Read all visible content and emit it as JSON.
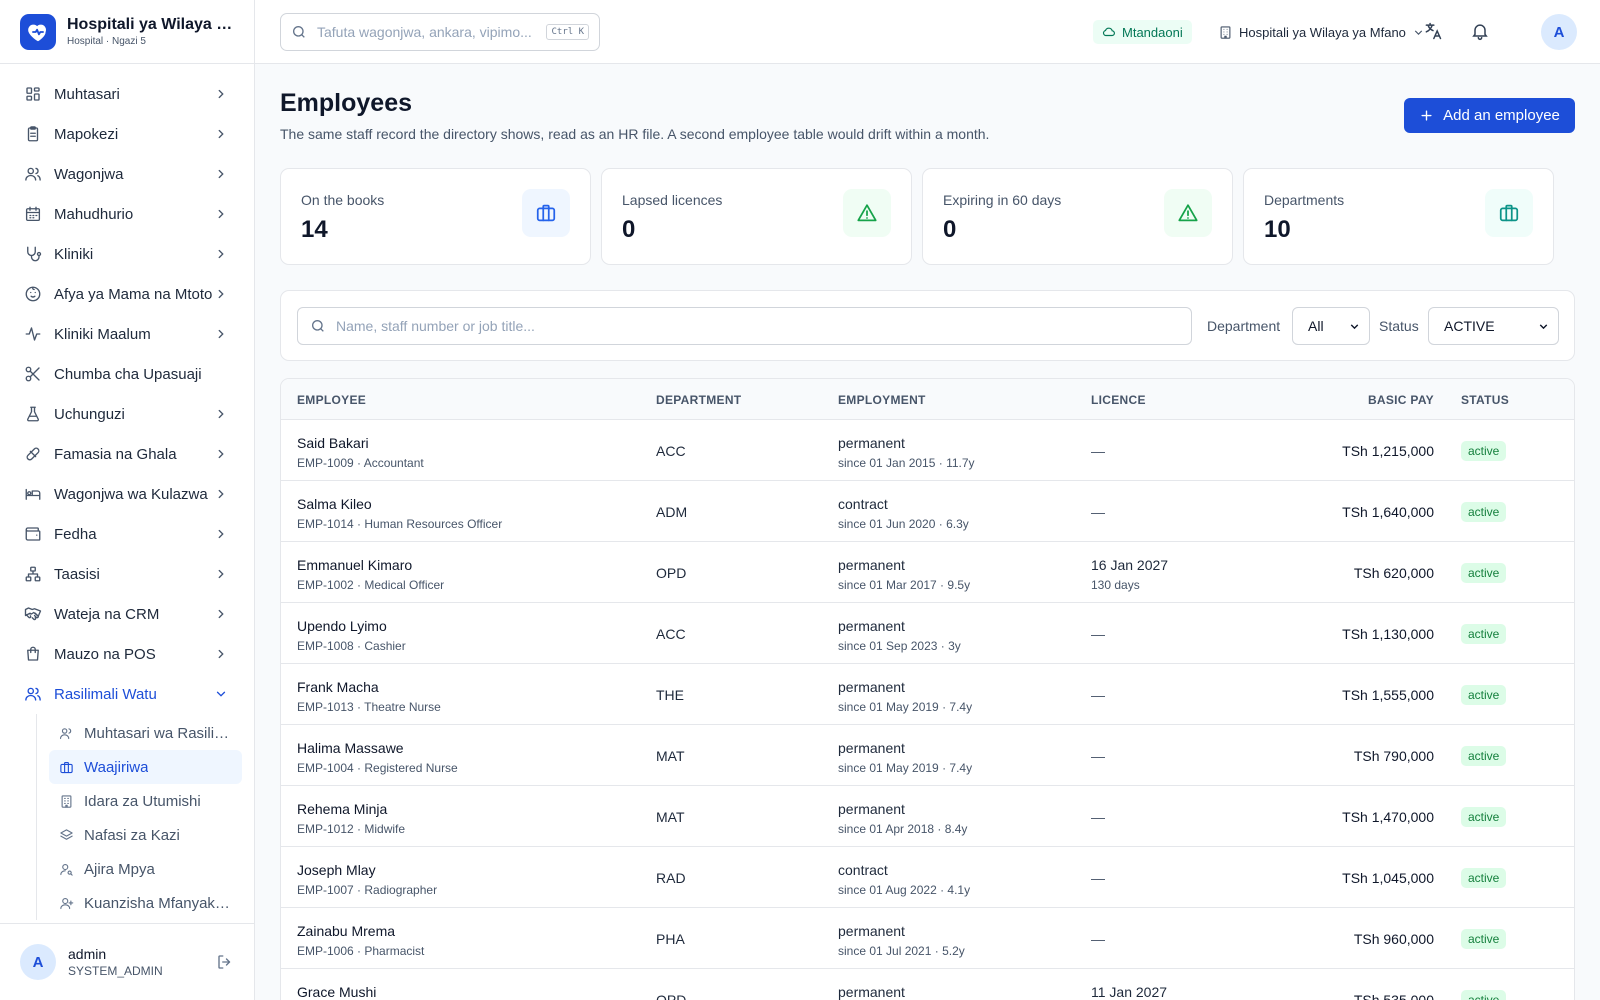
{
  "brand": {
    "title": "Hospitali ya Wilaya ya Mfano",
    "subtitle": "Hospital · Ngazi 5"
  },
  "nav": [
    {
      "label": "Muhtasari",
      "icon": "dashboard-icon",
      "chevron": "right"
    },
    {
      "label": "Mapokezi",
      "icon": "clipboard-icon",
      "chevron": "right"
    },
    {
      "label": "Wagonjwa",
      "icon": "users-icon",
      "chevron": "right"
    },
    {
      "label": "Mahudhurio",
      "icon": "calendar-icon",
      "chevron": "right"
    },
    {
      "label": "Kliniki",
      "icon": "stethoscope-icon",
      "chevron": "right"
    },
    {
      "label": "Afya ya Mama na Mtoto",
      "icon": "baby-icon",
      "chevron": "right"
    },
    {
      "label": "Kliniki Maalum",
      "icon": "activity-icon",
      "chevron": "right"
    },
    {
      "label": "Chumba cha Upasuaji",
      "icon": "scissors-icon",
      "chevron": ""
    },
    {
      "label": "Uchunguzi",
      "icon": "flask-icon",
      "chevron": "right"
    },
    {
      "label": "Famasia na Ghala",
      "icon": "pill-icon",
      "chevron": "right"
    },
    {
      "label": "Wagonjwa wa Kulazwa",
      "icon": "bed-icon",
      "chevron": "right"
    },
    {
      "label": "Fedha",
      "icon": "wallet-icon",
      "chevron": "right"
    },
    {
      "label": "Taasisi",
      "icon": "org-chart-icon",
      "chevron": "right"
    },
    {
      "label": "Wateja na CRM",
      "icon": "handshake-icon",
      "chevron": "right"
    },
    {
      "label": "Mauzo na POS",
      "icon": "shopping-bag-icon",
      "chevron": "right"
    },
    {
      "label": "Rasilimali Watu",
      "icon": "users-icon",
      "chevron": "down"
    }
  ],
  "subnav": [
    {
      "label": "Muhtasari wa Rasilimali Watu",
      "icon": "users-small-icon",
      "active": false
    },
    {
      "label": "Waajiriwa",
      "icon": "briefcase-icon",
      "active": true
    },
    {
      "label": "Idara za Utumishi",
      "icon": "building-icon",
      "active": false
    },
    {
      "label": "Nafasi za Kazi",
      "icon": "layers-icon",
      "active": false
    },
    {
      "label": "Ajira Mpya",
      "icon": "user-search-icon",
      "active": false
    },
    {
      "label": "Kuanzisha Mfanyakazi",
      "icon": "user-plus-icon",
      "active": false
    }
  ],
  "user": {
    "initial": "A",
    "name": "admin",
    "role": "SYSTEM_ADMIN"
  },
  "topbar": {
    "search_placeholder": "Tafuta wagonjwa, ankara, vipimo...",
    "shortcut": "Ctrl K",
    "status": "Mtandaoni",
    "facility": "Hospitali ya Wilaya ya Mfano",
    "avatar_initial": "A"
  },
  "page": {
    "title": "Employees",
    "subtitle": "The same staff record the directory shows, read as an HR file. A second employee table would drift within a month.",
    "add_button": "Add an employee"
  },
  "kpis": [
    {
      "label": "On the books",
      "value": "14",
      "icon": "briefcase-icon",
      "icon_color": "#2563eb",
      "icon_bg": "#eff6ff"
    },
    {
      "label": "Lapsed licences",
      "value": "0",
      "icon": "alert-triangle-icon",
      "icon_color": "#16a34a",
      "icon_bg": "#f0fdf4"
    },
    {
      "label": "Expiring in 60 days",
      "value": "0",
      "icon": "alert-triangle-icon",
      "icon_color": "#16a34a",
      "icon_bg": "#f0fdf4"
    },
    {
      "label": "Departments",
      "value": "10",
      "icon": "briefcase-icon",
      "icon_color": "#0d9488",
      "icon_bg": "#f0fdfa"
    }
  ],
  "filters": {
    "search_placeholder": "Name, staff number or job title...",
    "department_label": "Department",
    "department_value": "All",
    "status_label": "Status",
    "status_value": "ACTIVE"
  },
  "table": {
    "headers": {
      "employee": "EMPLOYEE",
      "department": "DEPARTMENT",
      "employment": "EMPLOYMENT",
      "licence": "LICENCE",
      "basic_pay": "BASIC PAY",
      "status": "STATUS"
    },
    "rows": [
      {
        "name": "Said Bakari",
        "meta": "EMP-1009 · Accountant",
        "dept": "ACC",
        "type": "permanent",
        "since": "since 01 Jan 2015 · 11.7y",
        "licence": "—",
        "licence_sub": "",
        "pay": "TSh 1,215,000",
        "status": "active"
      },
      {
        "name": "Salma Kileo",
        "meta": "EMP-1014 · Human Resources Officer",
        "dept": "ADM",
        "type": "contract",
        "since": "since 01 Jun 2020 · 6.3y",
        "licence": "—",
        "licence_sub": "",
        "pay": "TSh 1,640,000",
        "status": "active"
      },
      {
        "name": "Emmanuel Kimaro",
        "meta": "EMP-1002 · Medical Officer",
        "dept": "OPD",
        "type": "permanent",
        "since": "since 01 Mar 2017 · 9.5y",
        "licence": "16 Jan 2027",
        "licence_sub": "130 days",
        "pay": "TSh 620,000",
        "status": "active"
      },
      {
        "name": "Upendo Lyimo",
        "meta": "EMP-1008 · Cashier",
        "dept": "ACC",
        "type": "permanent",
        "since": "since 01 Sep 2023 · 3y",
        "licence": "—",
        "licence_sub": "",
        "pay": "TSh 1,130,000",
        "status": "active"
      },
      {
        "name": "Frank Macha",
        "meta": "EMP-1013 · Theatre Nurse",
        "dept": "THE",
        "type": "permanent",
        "since": "since 01 May 2019 · 7.4y",
        "licence": "—",
        "licence_sub": "",
        "pay": "TSh 1,555,000",
        "status": "active"
      },
      {
        "name": "Halima Massawe",
        "meta": "EMP-1004 · Registered Nurse",
        "dept": "MAT",
        "type": "permanent",
        "since": "since 01 May 2019 · 7.4y",
        "licence": "—",
        "licence_sub": "",
        "pay": "TSh 790,000",
        "status": "active"
      },
      {
        "name": "Rehema Minja",
        "meta": "EMP-1012 · Midwife",
        "dept": "MAT",
        "type": "permanent",
        "since": "since 01 Apr 2018 · 8.4y",
        "licence": "—",
        "licence_sub": "",
        "pay": "TSh 1,470,000",
        "status": "active"
      },
      {
        "name": "Joseph Mlay",
        "meta": "EMP-1007 · Radiographer",
        "dept": "RAD",
        "type": "contract",
        "since": "since 01 Aug 2022 · 4.1y",
        "licence": "—",
        "licence_sub": "",
        "pay": "TSh 1,045,000",
        "status": "active"
      },
      {
        "name": "Zainabu Mrema",
        "meta": "EMP-1006 · Pharmacist",
        "dept": "PHA",
        "type": "permanent",
        "since": "since 01 Jul 2021 · 5.2y",
        "licence": "—",
        "licence_sub": "",
        "pay": "TSh 960,000",
        "status": "active"
      },
      {
        "name": "Grace Mushi",
        "meta": "",
        "dept": "OPD",
        "type": "permanent",
        "since": "",
        "licence": "11 Jan 2027",
        "licence_sub": "",
        "pay": "TSh 535,000",
        "status": "active"
      }
    ]
  }
}
